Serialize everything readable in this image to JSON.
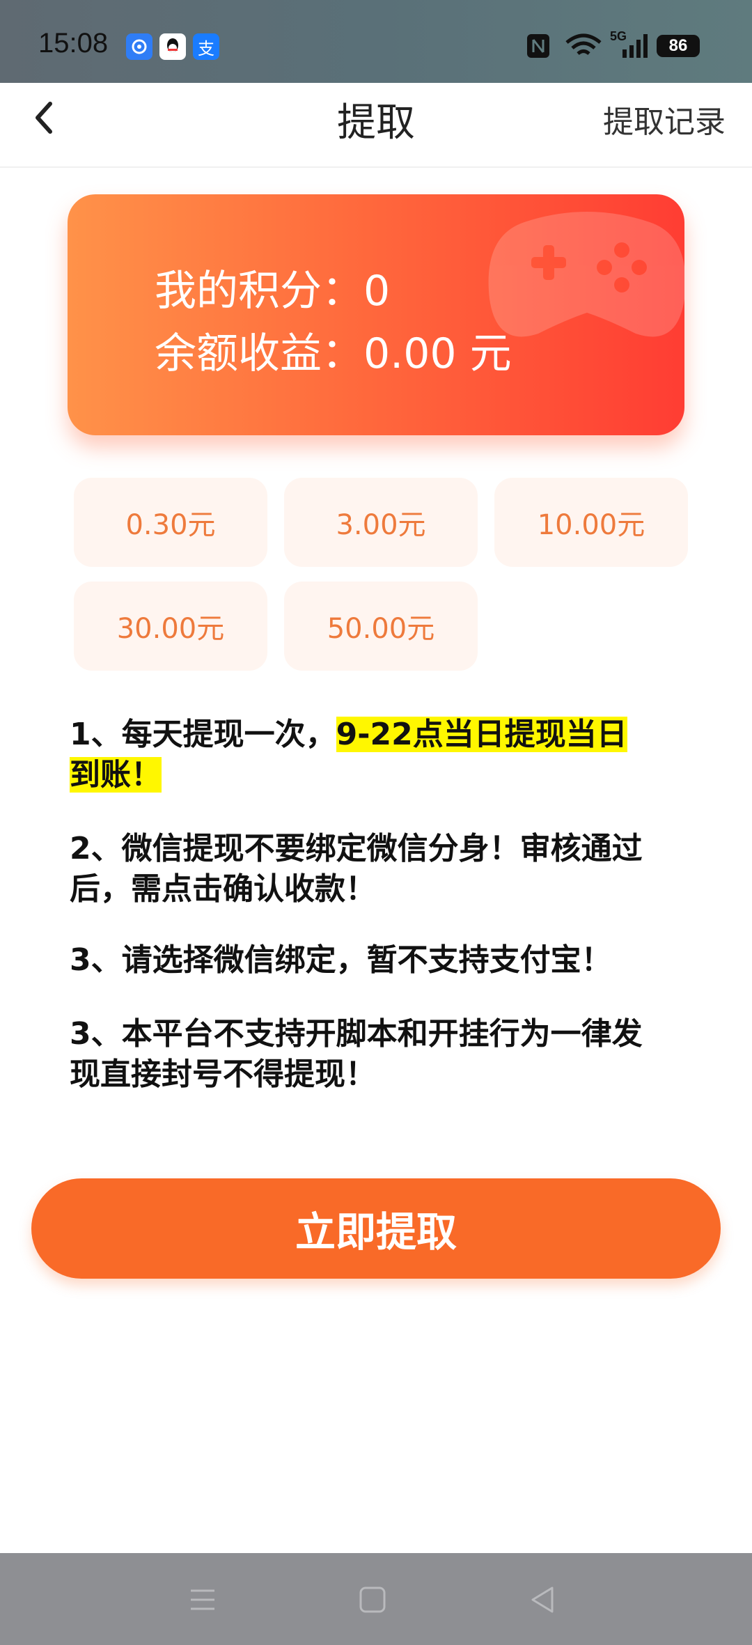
{
  "status_bar": {
    "time": "15:08",
    "app_icons": [
      "pinwheel-app-icon",
      "qq-icon",
      "alipay-icon"
    ],
    "alipay_glyph": "支",
    "network": "5G",
    "battery": "86"
  },
  "nav": {
    "title": "提取",
    "right_link": "提取记录"
  },
  "card": {
    "points_label": "我的积分：",
    "points_value": "0",
    "balance_label": "余额收益：",
    "balance_value": "0.00 元"
  },
  "amounts": [
    "0.30元",
    "3.00元",
    "10.00元",
    "30.00元",
    "50.00元"
  ],
  "notes": {
    "n1_plain": "1、每天提现一次，",
    "n1_highlight_a": "9-22点当日提现当日",
    "n1_highlight_b": "到账！",
    "n2": "2、微信提现不要绑定微信分身！审核通过后，需点击确认收款！",
    "n3": "3、请选择微信绑定，暂不支持支付宝！",
    "n4": "3、本平台不支持开脚本和开挂行为一律发现直接封号不得提现！"
  },
  "button": {
    "label": "立即提取"
  },
  "colors": {
    "accent": "#f96a28",
    "amount_bg": "#fff5f0",
    "amount_text": "#ee7a3c",
    "highlight": "#fff700"
  }
}
